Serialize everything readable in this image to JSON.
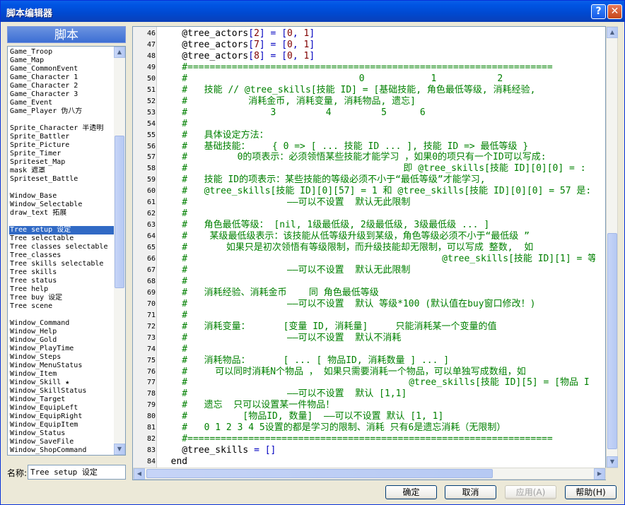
{
  "window": {
    "title": "脚本编辑器",
    "help_glyph": "?",
    "close_glyph": "✕"
  },
  "sidebar": {
    "header": "脚本",
    "items": [
      "Game_Troop",
      "Game_Map",
      "Game_CommonEvent",
      "Game_Character 1",
      "Game_Character 2",
      "Game_Character 3",
      "Game_Event",
      "Game_Player 伪八方",
      "",
      "Sprite_Character 半透明",
      "Sprite_Battler",
      "Sprite_Picture",
      "Sprite_Timer",
      "Spriteset_Map",
      "mask 遮罩",
      "Spriteset_Battle",
      "",
      "Window_Base",
      "Window_Selectable",
      "draw_text 拓展",
      "",
      "Tree setup 设定",
      "Tree selectable",
      "Tree classes selectable",
      "Tree_classes",
      "Tree skills selectable",
      "Tree skills",
      "Tree status",
      "Tree help",
      "Tree buy 设定",
      "Tree scene",
      "",
      "Window_Command",
      "Window_Help",
      "Window_Gold",
      "Window_PlayTime",
      "Window_Steps",
      "Window_MenuStatus",
      "Window_Item",
      "Window_Skill ★",
      "Window_SkillStatus",
      "Window_Target",
      "Window_EquipLeft",
      "Window_EquipRight",
      "Window_EquipItem",
      "Window_Status",
      "Window_SaveFile",
      "Window_ShopCommand"
    ],
    "selected_index": 21
  },
  "name_field": {
    "label": "名称:",
    "value": "Tree setup 设定"
  },
  "editor": {
    "lines": [
      {
        "n": "46",
        "t": "    @tree_actors[2] = [0, 1]",
        "k": "n"
      },
      {
        "n": "47",
        "t": "    @tree_actors[7] = [0, 1]",
        "k": "n"
      },
      {
        "n": "48",
        "t": "    @tree_actors[8] = [0, 1]",
        "k": "n"
      },
      {
        "n": "49",
        "t": "    #==================================================================",
        "k": "c"
      },
      {
        "n": "50",
        "t": "    #                               0            1           2",
        "k": "c"
      },
      {
        "n": "51",
        "t": "    #   技能 // @tree_skills[技能 ID] = [基础技能, 角色最低等级, 消耗经验,",
        "k": "c"
      },
      {
        "n": "52",
        "t": "    #           消耗金币, 消耗变量, 消耗物品, 遗忘]",
        "k": "c"
      },
      {
        "n": "53",
        "t": "    #               3         4         5      6",
        "k": "c"
      },
      {
        "n": "54",
        "t": "    #",
        "k": "c"
      },
      {
        "n": "55",
        "t": "    #   具体设定方法：",
        "k": "c"
      },
      {
        "n": "56",
        "t": "    #   基础技能：    { 0 => [ ... 技能 ID ... ], 技能 ID => 最低等级 }",
        "k": "c"
      },
      {
        "n": "57",
        "t": "    #         0的项表示：必须领悟某些技能才能学习 ，如果0的项只有一个ID可以写成:",
        "k": "c"
      },
      {
        "n": "58",
        "t": "    #                                       即 @tree_skills[技能 ID][0][0] = :",
        "k": "c"
      },
      {
        "n": "59",
        "t": "    #   技能 ID的项表示：某些技能的等级必须不小于“最低等级”才能学习,",
        "k": "c"
      },
      {
        "n": "60",
        "t": "    #   @tree_skills[技能 ID][0][57] = 1 和 @tree_skills[技能 ID][0][0] = 57 是:",
        "k": "c"
      },
      {
        "n": "61",
        "t": "    #                  ——可以不设置  默认无此限制",
        "k": "c"
      },
      {
        "n": "62",
        "t": "    #",
        "k": "c"
      },
      {
        "n": "63",
        "t": "    #   角色最低等级： [nil, 1级最低级, 2级最低级, 3级最低级 ... ]",
        "k": "c"
      },
      {
        "n": "64",
        "t": "    #    某级最低级表示：该技能从低等级升级到某级，角色等级必须不小于“最低级 ”",
        "k": "c"
      },
      {
        "n": "65",
        "t": "    #       如果只是初次领悟有等级限制，而升级技能却无限制，可以写成 整数,  如",
        "k": "c"
      },
      {
        "n": "66",
        "t": "    #                                              @tree_skills[技能 ID][1] = 等",
        "k": "c"
      },
      {
        "n": "67",
        "t": "    #                  ——可以不设置  默认无此限制",
        "k": "c"
      },
      {
        "n": "68",
        "t": "    #",
        "k": "c"
      },
      {
        "n": "69",
        "t": "    #   消耗经验、消耗金币    同 角色最低等级",
        "k": "c"
      },
      {
        "n": "70",
        "t": "    #                  ——可以不设置  默认 等级*100 (默认值在buy窗口修改！)",
        "k": "c"
      },
      {
        "n": "71",
        "t": "    #",
        "k": "c"
      },
      {
        "n": "72",
        "t": "    #   消耗变量：      [变量 ID, 消耗量]     只能消耗某一个变量的值",
        "k": "c"
      },
      {
        "n": "73",
        "t": "    #                  ——可以不设置  默认不消耗",
        "k": "c"
      },
      {
        "n": "74",
        "t": "    #",
        "k": "c"
      },
      {
        "n": "75",
        "t": "    #   消耗物品：      [ ... [ 物品ID, 消耗数量 ] ... ]",
        "k": "c"
      },
      {
        "n": "76",
        "t": "    #     可以同时消耗N个物品 ， 如果只需要消耗一个物品，可以单独写成数组，如",
        "k": "c"
      },
      {
        "n": "77",
        "t": "    #                                        @tree_skills[技能 ID][5] = [物品 I",
        "k": "c"
      },
      {
        "n": "78",
        "t": "    #                  ——可以不设置  默认 [1,1]",
        "k": "c"
      },
      {
        "n": "79",
        "t": "    #   遗忘  只可以设置某一件物品！",
        "k": "c"
      },
      {
        "n": "80",
        "t": "    #          [物品ID, 数量]  ——可以不设置 默认 [1, 1]",
        "k": "c"
      },
      {
        "n": "81",
        "t": "    #   0 1 2 3 4 5设置的都是学习的限制、消耗 只有6是遗忘消耗（无限制）",
        "k": "c"
      },
      {
        "n": "82",
        "t": "    #==================================================================",
        "k": "c"
      },
      {
        "n": "83",
        "t": "    @tree_skills = []",
        "k": "n"
      },
      {
        "n": "84",
        "t": "  end",
        "k": "n"
      }
    ]
  },
  "buttons": {
    "ok": "确定",
    "cancel": "取消",
    "apply": "应用(A)",
    "help": "帮助(H)"
  },
  "colors": {
    "comment": "#008000",
    "number": "#800000",
    "operator": "#0000c0",
    "selection": "#316ac5",
    "titlebar": "#0054e3"
  }
}
